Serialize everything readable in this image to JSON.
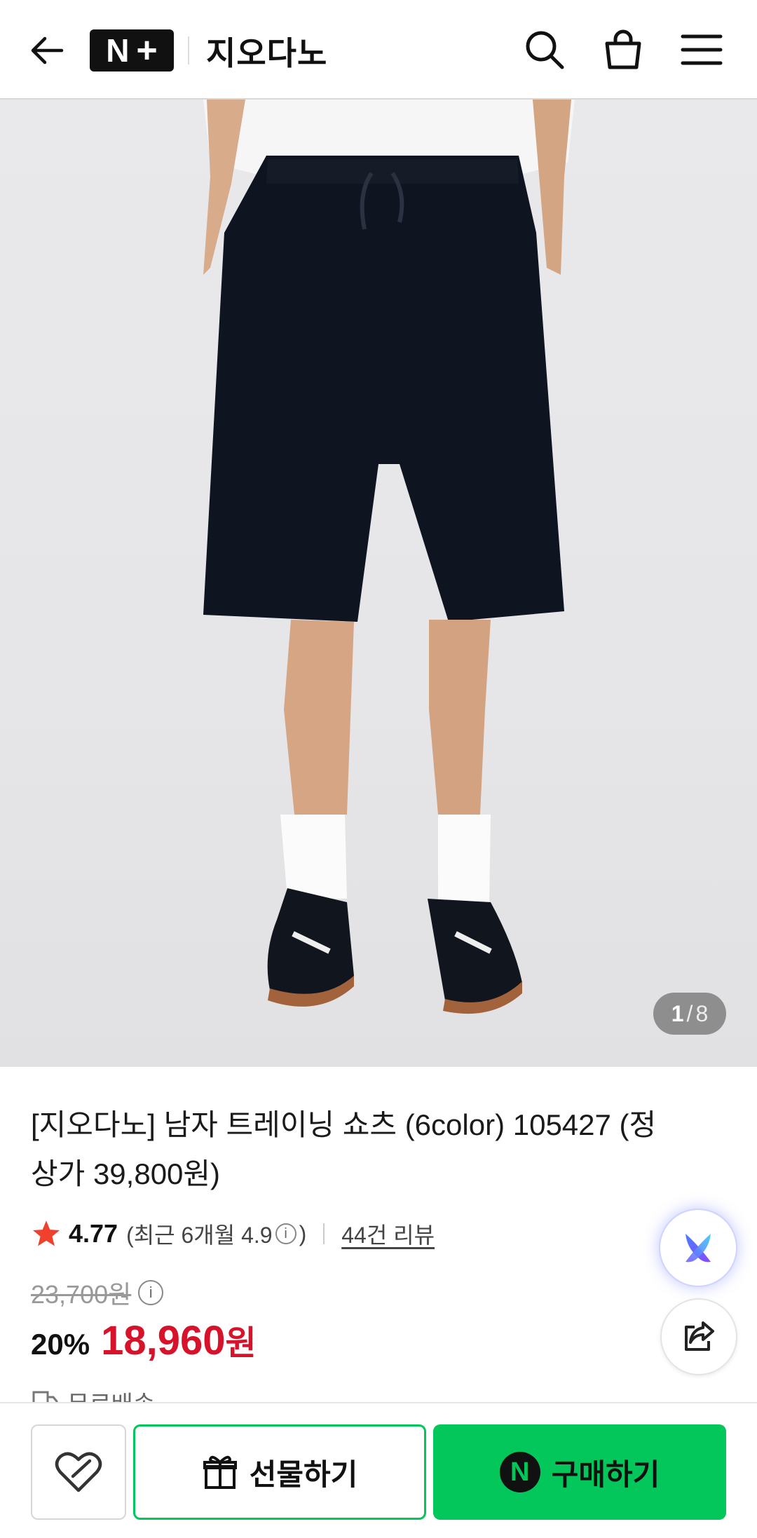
{
  "header": {
    "logo_text": "N",
    "logo_plus": "+",
    "store_name": "지오다노"
  },
  "gallery": {
    "current": "1",
    "separator": "/",
    "total": "8"
  },
  "product": {
    "title": "[지오다노] 남자 트레이닝 쇼츠 (6color) 105427 (정상가 39,800원)",
    "rating": "4.77",
    "rating_recent_prefix": "(최근 6개월 4.9",
    "rating_recent_suffix": ")",
    "review_count": "44건 리뷰",
    "original_price": "23,700원",
    "discount_rate": "20%",
    "sale_price": "18,960",
    "currency": "원",
    "shipping": "무료배송"
  },
  "actions": {
    "gift_label": "선물하기",
    "buy_label": "구매하기",
    "npay_letter": "N"
  },
  "colors": {
    "accent_green": "#03c75a",
    "price_red": "#d6132a",
    "star_red": "#f0412e"
  }
}
